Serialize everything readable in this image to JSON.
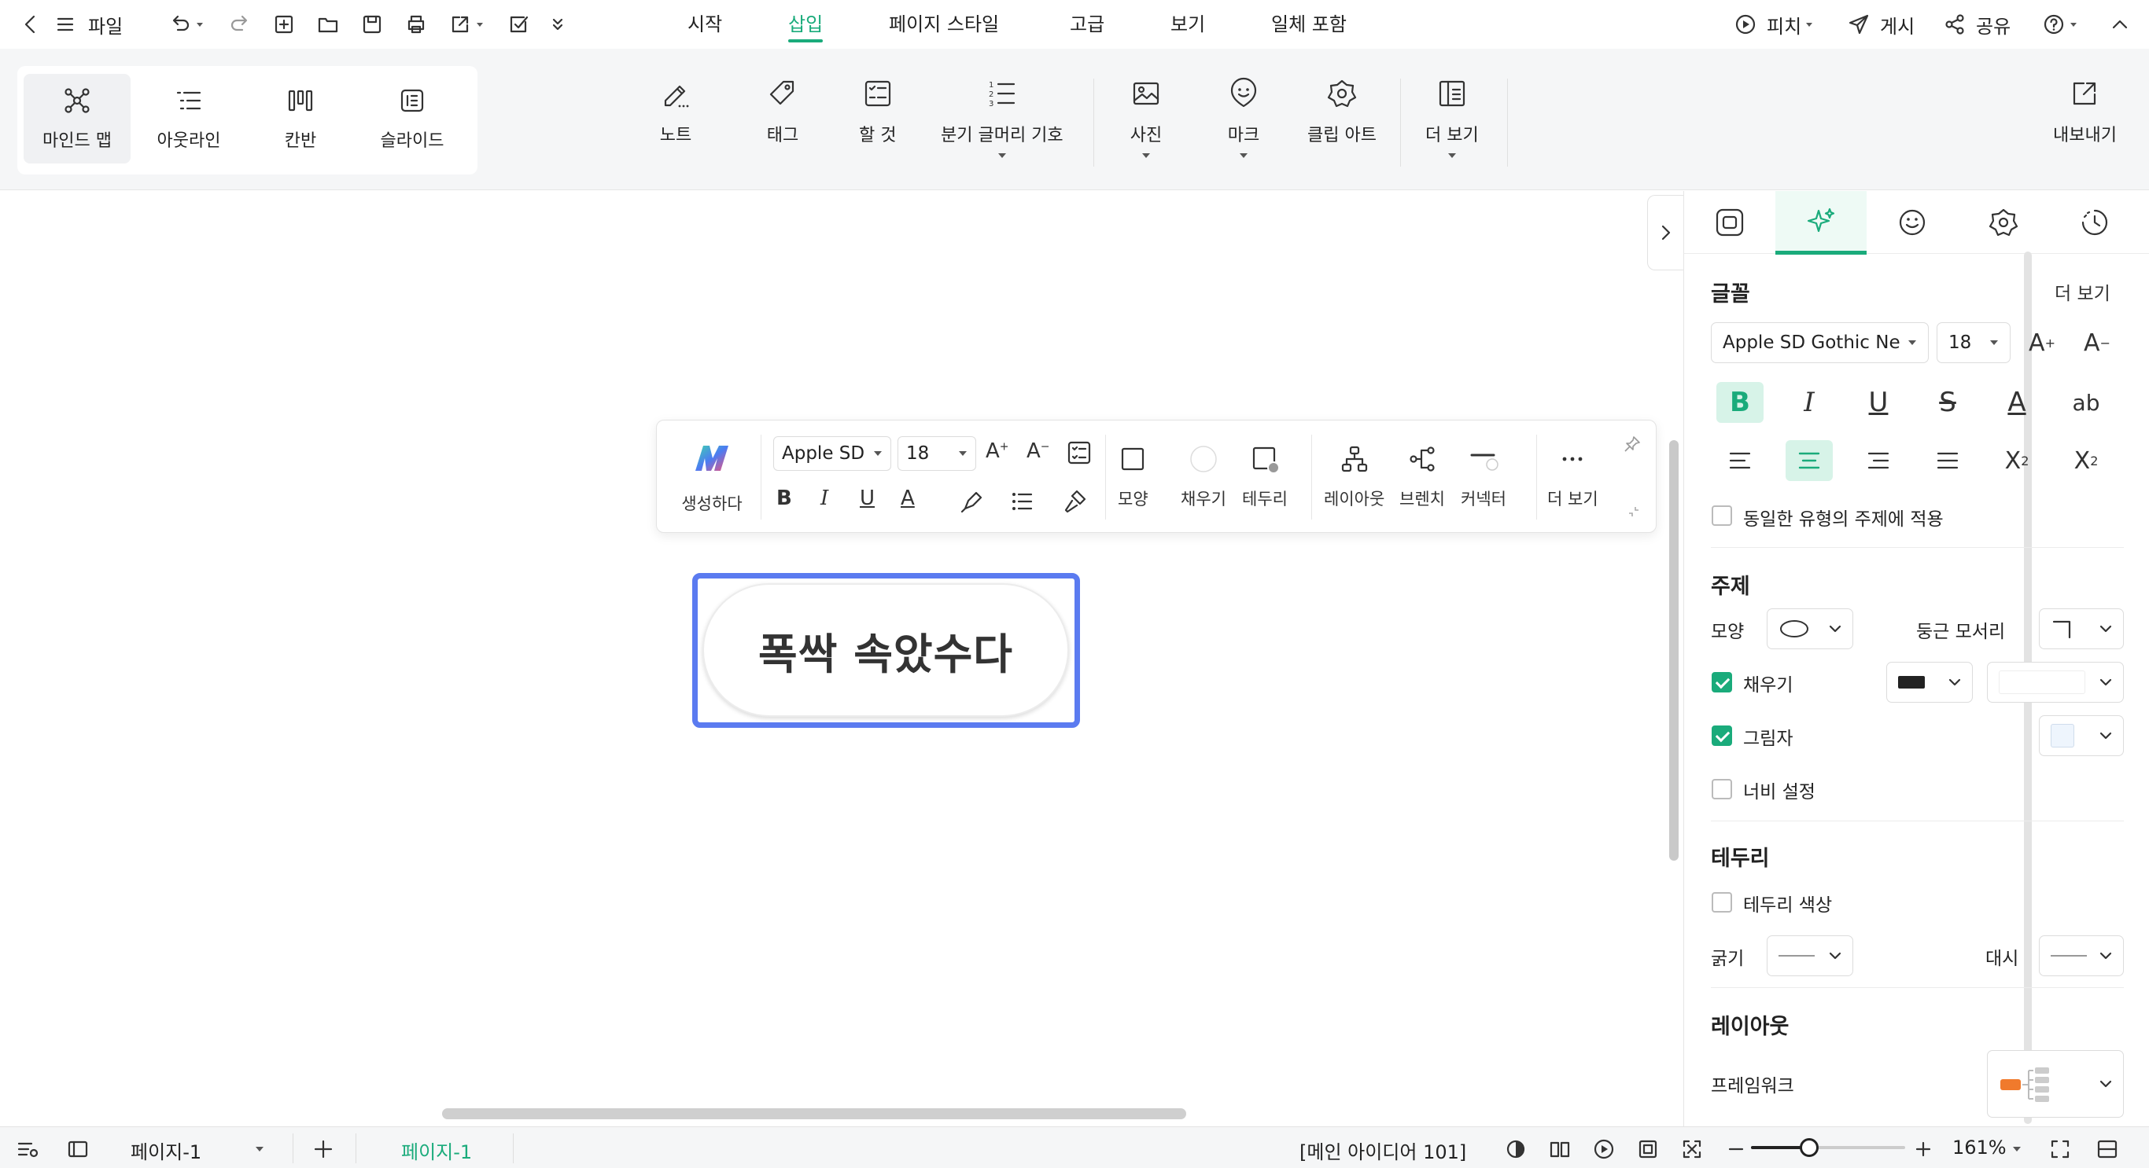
{
  "topbar": {
    "file_label": "파일",
    "tabs": [
      {
        "label": "시작"
      },
      {
        "label": "삽입"
      },
      {
        "label": "페이지 스타일"
      },
      {
        "label": "고급"
      },
      {
        "label": "보기"
      },
      {
        "label": "일체 포함"
      }
    ],
    "active_tab": "삽입",
    "pitch_label": "피치",
    "publish_label": "게시",
    "share_label": "공유"
  },
  "ribbon": {
    "views": [
      {
        "label": "마인드 맵"
      },
      {
        "label": "아웃라인"
      },
      {
        "label": "칸반"
      },
      {
        "label": "슬라이드"
      }
    ],
    "tools": [
      {
        "label": "노트"
      },
      {
        "label": "태그"
      },
      {
        "label": "할 것"
      },
      {
        "label": "분기 글머리 기호"
      },
      {
        "label": "사진"
      },
      {
        "label": "마크"
      },
      {
        "label": "클립 아트"
      },
      {
        "label": "더 보기"
      }
    ],
    "export_label": "내보내기"
  },
  "float_toolbar": {
    "generate_label": "생성하다",
    "font": "Apple SD",
    "size": "18",
    "shape_label": "모양",
    "fill_label": "채우기",
    "border_label": "테두리",
    "layout_label": "레이아웃",
    "branch_label": "브렌치",
    "connector_label": "커넥터",
    "more_label": "더 보기"
  },
  "canvas": {
    "topic_text": "폭싹 속았수다"
  },
  "panel": {
    "font_section": {
      "title": "글꼴",
      "more_label": "더 보기",
      "font_value": "Apple SD Gothic Ne",
      "size_value": "18",
      "apply_same_label": "동일한 유형의 주제에 적용"
    },
    "topic_section": {
      "title": "주제",
      "shape_label": "모양",
      "corner_label": "둥근 모서리",
      "fill_label": "채우기",
      "fill_checked": true,
      "shadow_label": "그림자",
      "shadow_checked": true,
      "width_label": "너비 설정",
      "width_checked": false
    },
    "border_section": {
      "title": "테두리",
      "color_label": "테두리 색상",
      "thickness_label": "굵기",
      "dash_label": "대시"
    },
    "layout_section": {
      "title": "레이아웃",
      "framework_label": "프레임워크"
    }
  },
  "statusbar": {
    "page_select": "페이지-1",
    "active_page_tab": "페이지-1",
    "info_text": "[메인 아이디어 101]",
    "zoom_text": "161%"
  },
  "colors": {
    "accent": "#1aab7b",
    "selection": "#5b7bf0",
    "framework_orange": "#f07a2c"
  }
}
